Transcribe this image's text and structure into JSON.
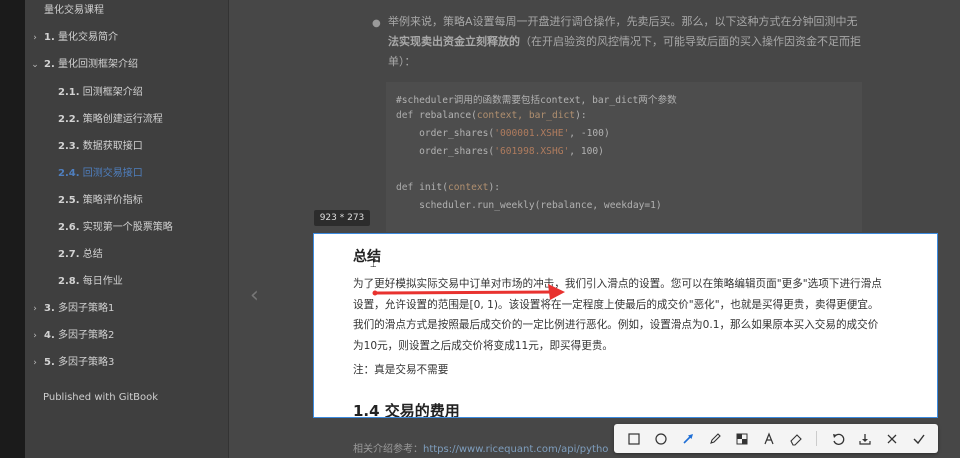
{
  "sidebar": {
    "header": "量化交易课程",
    "items": [
      {
        "caret": "›",
        "num": "1.",
        "label": "量化交易简介"
      },
      {
        "caret": "⌄",
        "num": "2.",
        "label": "量化回测框架介绍"
      },
      {
        "caret": "",
        "num": "2.1.",
        "label": "回测框架介绍"
      },
      {
        "caret": "",
        "num": "2.2.",
        "label": "策略创建运行流程"
      },
      {
        "caret": "",
        "num": "2.3.",
        "label": "数据获取接口"
      },
      {
        "caret": "",
        "num": "2.4.",
        "label": "回测交易接口"
      },
      {
        "caret": "",
        "num": "2.5.",
        "label": "策略评价指标"
      },
      {
        "caret": "",
        "num": "2.6.",
        "label": "实现第一个股票策略"
      },
      {
        "caret": "",
        "num": "2.7.",
        "label": "总结"
      },
      {
        "caret": "",
        "num": "2.8.",
        "label": "每日作业"
      },
      {
        "caret": "›",
        "num": "3.",
        "label": "多因子策略1"
      },
      {
        "caret": "›",
        "num": "4.",
        "label": "多因子策略2"
      },
      {
        "caret": "›",
        "num": "5.",
        "label": "多因子策略3"
      }
    ],
    "footer": "Published with GitBook"
  },
  "main": {
    "paragraph_line1": "举例来说，策略A设置每周一开盘进行调仓操作，先卖后买。那么，以下这种方式在分钟回测中无",
    "paragraph_line2_bold": "法实现卖出资金立刻释放的",
    "paragraph_line2_rest": "（在开启验资的风控情况下，可能导致后面的买入操作因资金不足而拒",
    "paragraph_line3": "单）：",
    "code": {
      "comment": "#scheduler调用的函数需要包括context, bar_dict两个参数",
      "l1_def": "def ",
      "l1_name": "rebalance(",
      "l1_params": "context, bar_dict",
      "l1_end": "):",
      "l2_fn": "    order_shares(",
      "l2_str": "'000001.XSHE'",
      "l2_end": ", -100)",
      "l3_fn": "    order_shares(",
      "l3_str": "'601998.XSHG'",
      "l3_end": ", 100)",
      "l4_def": "def ",
      "l4_name": "init(",
      "l4_params": "context",
      "l4_end": "):",
      "l5": "    scheduler.run_weekly(rebalance, weekday=1)"
    },
    "nav_prev": "‹"
  },
  "capture": {
    "size_label": "923 * 273",
    "title": "总结",
    "paragraph": "为了更好模拟实际交易中订单对市场的冲击，我们引入滑点的设置。您可以在策略编辑页面\"更多\"选项下进行滑点设置，允许设置的范围是[0, 1)。该设置将在一定程度上使最后的成交价\"恶化\"，也就是买得更贵，卖得更便宜。我们的滑点方式是按照最后成交价的一定比例进行恶化。例如，设置滑点为0.1，那么如果原本买入交易的成交价为10元，则设置之后成交价将变成11元，即买得更贵。",
    "note": "注：真是交易不需要",
    "section_heading": "1.4 交易的费用"
  },
  "below": {
    "prefix": "相关介绍参考：",
    "link": "https://www.ricequant.com/api/pytho"
  },
  "colors": {
    "accent_arrow": "#e8322f",
    "selection_border": "#3c8be0",
    "active_link": "#4f7fbf"
  },
  "toolbar": {
    "tools": [
      "rectangle-icon",
      "ellipse-icon",
      "arrow-icon",
      "pen-icon",
      "mosaic-icon",
      "text-icon",
      "eraser-icon",
      "undo-icon",
      "download-icon",
      "close-icon",
      "confirm-icon"
    ]
  }
}
